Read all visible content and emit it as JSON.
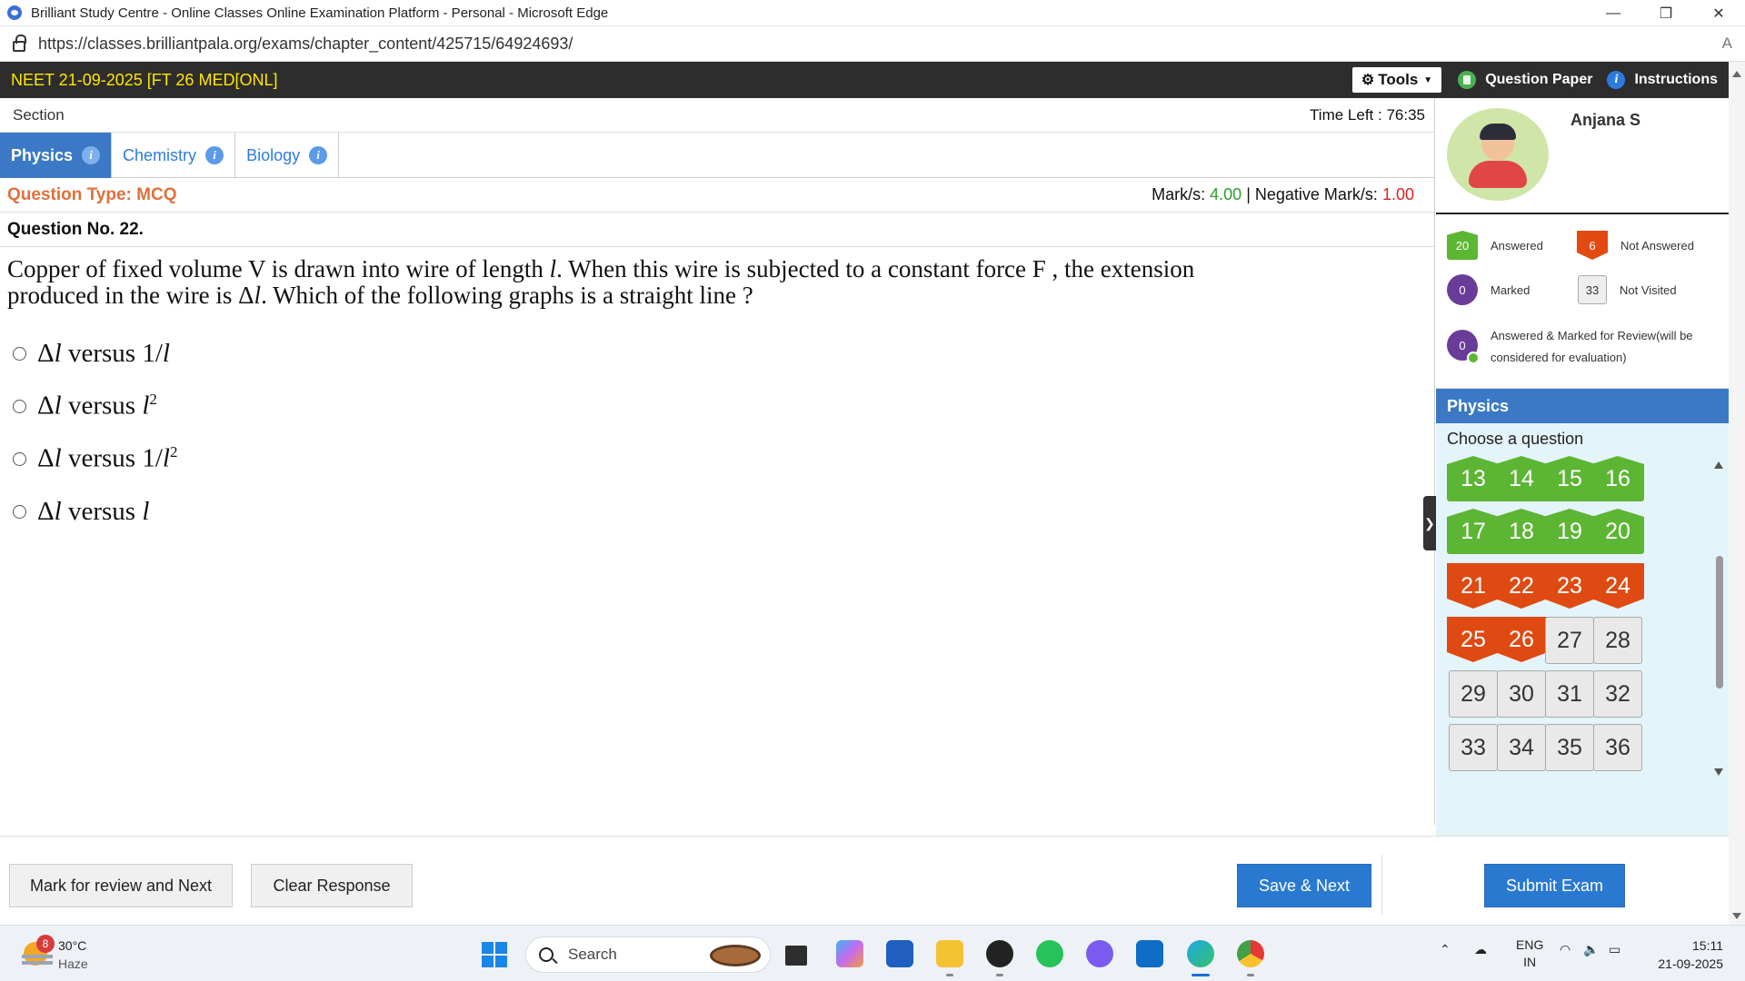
{
  "browser": {
    "window_title": "Brilliant Study Centre - Online Classes Online Examination Platform - Personal - Microsoft Edge",
    "url": "https://classes.brilliantpala.org/exams/chapter_content/425715/64924693/",
    "read_aloud": "A",
    "controls": {
      "minimize": "—",
      "restore": "❐",
      "close": "✕"
    }
  },
  "exam": {
    "title": "NEET 21-09-2025 [FT 26 MED[ONL]",
    "tools_label": "Tools",
    "question_paper_label": "Question Paper",
    "instructions_label": "Instructions",
    "section_label": "Section",
    "time_left_label": "Time Left :",
    "time_left_value": "76:35"
  },
  "tabs": [
    {
      "label": "Physics",
      "active": true
    },
    {
      "label": "Chemistry",
      "active": false
    },
    {
      "label": "Biology",
      "active": false
    }
  ],
  "question": {
    "type_label": "Question Type: MCQ",
    "marks_label": "Mark/s:",
    "marks_value": "4.00",
    "separator": "|",
    "negative_label": "Negative Mark/s:",
    "negative_value": "1.00",
    "number_label": "Question No. 22.",
    "text_line1": "Copper of fixed volume V is drawn into wire of length ",
    "text_l": "l",
    "text_line1b": ". When this wire is subjected to a constant force F , the extension",
    "text_line2a": "produced in the wire is Δ",
    "text_line2b": ". Which of the following graphs is a straight line ?",
    "options": [
      {
        "delta": "Δ",
        "var": "l",
        "mid": " versus 1/",
        "rhs": "l",
        "sup": ""
      },
      {
        "delta": "Δ",
        "var": "l",
        "mid": " versus ",
        "rhs": "l",
        "sup": "2"
      },
      {
        "delta": "Δ",
        "var": "l",
        "mid": " versus 1/",
        "rhs": "l",
        "sup": "2"
      },
      {
        "delta": "Δ",
        "var": "l",
        "mid": " versus ",
        "rhs": "l",
        "sup": ""
      }
    ]
  },
  "user": {
    "name": "Anjana S"
  },
  "legend": {
    "answered_count": "20",
    "answered_label": "Answered",
    "not_answered_count": "6",
    "not_answered_label": "Not Answered",
    "marked_count": "0",
    "marked_label": "Marked",
    "not_visited_count": "33",
    "not_visited_label": "Not Visited",
    "amr_count": "0",
    "amr_label": "Answered & Marked for Review(will be considered for evaluation)"
  },
  "palette": {
    "section": "Physics",
    "choose_label": "Choose a question",
    "questions": [
      {
        "n": "13",
        "status": "answered"
      },
      {
        "n": "14",
        "status": "answered"
      },
      {
        "n": "15",
        "status": "answered"
      },
      {
        "n": "16",
        "status": "answered"
      },
      {
        "n": "17",
        "status": "answered"
      },
      {
        "n": "18",
        "status": "answered"
      },
      {
        "n": "19",
        "status": "answered"
      },
      {
        "n": "20",
        "status": "answered"
      },
      {
        "n": "21",
        "status": "not_answered"
      },
      {
        "n": "22",
        "status": "not_answered"
      },
      {
        "n": "23",
        "status": "not_answered"
      },
      {
        "n": "24",
        "status": "not_answered"
      },
      {
        "n": "25",
        "status": "not_answered"
      },
      {
        "n": "26",
        "status": "not_answered"
      },
      {
        "n": "27",
        "status": "not_visited"
      },
      {
        "n": "28",
        "status": "not_visited"
      },
      {
        "n": "29",
        "status": "not_visited"
      },
      {
        "n": "30",
        "status": "not_visited"
      },
      {
        "n": "31",
        "status": "not_visited"
      },
      {
        "n": "32",
        "status": "not_visited"
      },
      {
        "n": "33",
        "status": "not_visited"
      },
      {
        "n": "34",
        "status": "not_visited"
      },
      {
        "n": "35",
        "status": "not_visited"
      },
      {
        "n": "36",
        "status": "not_visited"
      }
    ]
  },
  "actions": {
    "mark_review": "Mark for review and Next",
    "clear": "Clear Response",
    "save_next": "Save & Next",
    "submit": "Submit Exam"
  },
  "taskbar": {
    "weather_temp": "30°C",
    "weather_desc": "Haze",
    "weather_badge": "8",
    "search_label": "Search",
    "lang_top": "ENG",
    "lang_bottom": "IN",
    "time": "15:11",
    "date": "21-09-2025",
    "icons": [
      "task-view-icon",
      "copilot-icon",
      "store-icon",
      "file-explorer-icon",
      "dell-icon",
      "whatsapp-icon",
      "app-icon",
      "outlook-icon",
      "edge-icon",
      "chrome-icon"
    ]
  },
  "colors": {
    "accent_blue": "#3b79c7",
    "answered_green": "#5db534",
    "not_answered_red": "#df4a12",
    "marked_purple": "#6a3c9a",
    "exam_title_yellow": "#ffe600"
  }
}
